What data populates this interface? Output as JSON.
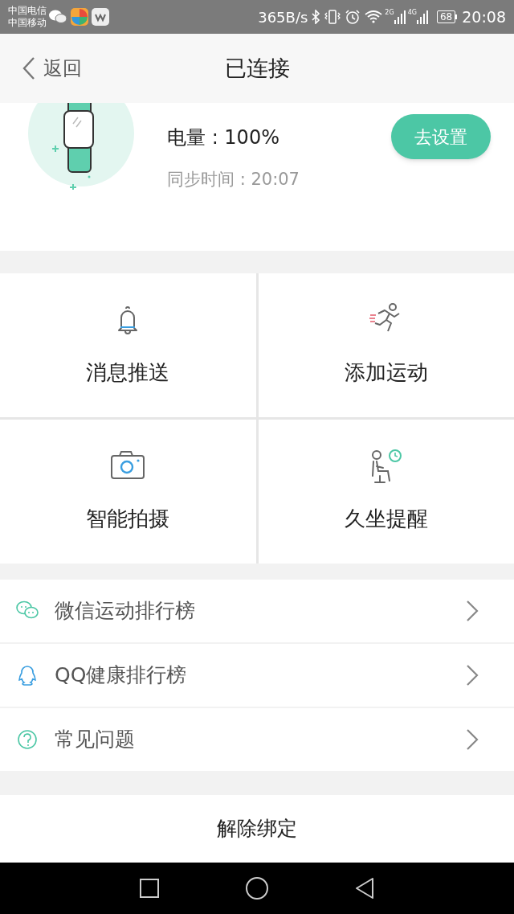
{
  "status_bar": {
    "carriers": [
      "中国电信",
      "中国移动"
    ],
    "speed": "365B/s",
    "signals": [
      {
        "label": "2G"
      },
      {
        "label": "4G"
      }
    ],
    "battery": "68",
    "time": "20:08"
  },
  "header": {
    "back_label": "返回",
    "title": "已连接"
  },
  "device": {
    "battery_label": "电量 : 100%",
    "sync_time": "同步时间 : 20:07",
    "button": "去设置"
  },
  "features": [
    {
      "kind": "bell",
      "label": "消息推送"
    },
    {
      "kind": "runner",
      "label": "添加运动"
    },
    {
      "kind": "camera",
      "label": "智能拍摄"
    },
    {
      "kind": "sitting",
      "label": "久坐提醒"
    }
  ],
  "links": [
    {
      "kind": "chat",
      "label": "微信运动排行榜"
    },
    {
      "kind": "penguin",
      "label": "QQ健康排行榜"
    },
    {
      "kind": "help",
      "label": "常见问题"
    }
  ],
  "unbind_button": "解除绑定"
}
